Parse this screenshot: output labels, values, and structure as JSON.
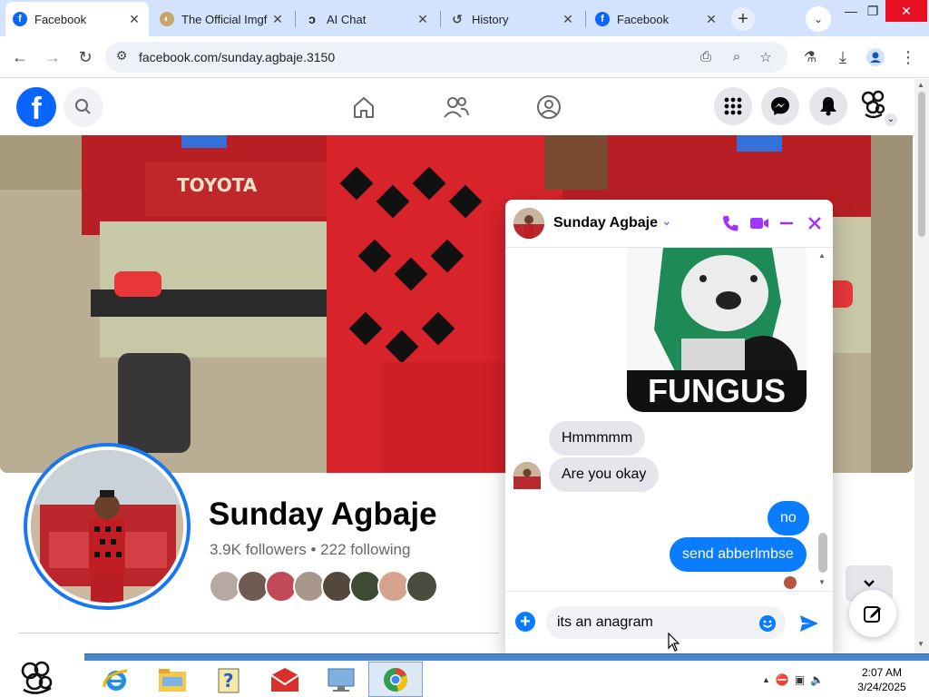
{
  "browser": {
    "tabs": [
      {
        "title": "Facebook",
        "icon": "facebook-icon",
        "active": true
      },
      {
        "title": "The Official Imgf",
        "icon": "imgflip-icon",
        "active": false
      },
      {
        "title": "AI Chat",
        "icon": "ai-chat-icon",
        "active": false
      },
      {
        "title": "History",
        "icon": "history-icon",
        "active": false
      },
      {
        "title": "Facebook",
        "icon": "facebook-icon",
        "active": false
      }
    ],
    "new_tab_label": "+",
    "url": "facebook.com/sunday.agbaje.3150"
  },
  "facebook": {
    "logo_letter": "f",
    "profile": {
      "name": "Sunday Agbaje",
      "stats": "3.9K followers • 222 following"
    }
  },
  "chat": {
    "contact_name": "Sunday Agbaje",
    "sticker_text": "FUNGUS",
    "messages": [
      {
        "direction": "in",
        "text": "Hmmmmm"
      },
      {
        "direction": "in",
        "text": "Are you okay"
      },
      {
        "direction": "out",
        "text": "no"
      },
      {
        "direction": "out",
        "text": "send abberlmbse"
      }
    ],
    "input_value": "its an anagram",
    "accent_color": "#a033ff",
    "bubble_color": "#0a7cff"
  },
  "taskbar": {
    "time": "2:07 AM",
    "date": "3/24/2025"
  },
  "colors": {
    "facebook_blue": "#0866ff",
    "tabstrip": "#d3e3fd"
  }
}
